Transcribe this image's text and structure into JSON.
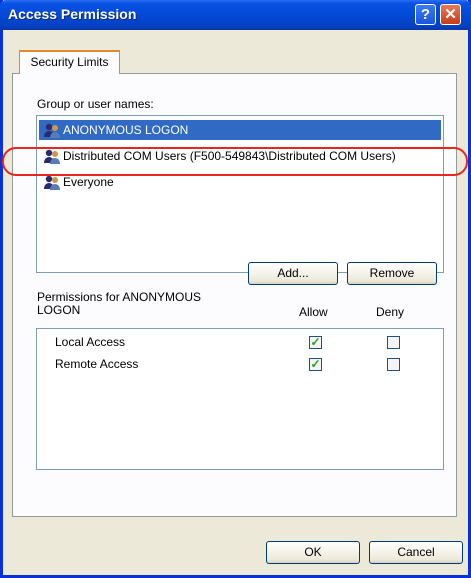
{
  "window": {
    "title": "Access Permission",
    "help_label": "?",
    "close_label": "✕"
  },
  "tab": {
    "label": "Security Limits"
  },
  "groups": {
    "label": "Group or user names:",
    "items": [
      {
        "name": "ANONYMOUS LOGON",
        "selected": true,
        "icon": "user-group-icon"
      },
      {
        "name": "Distributed COM Users (F500-549843\\Distributed COM Users)",
        "selected": false,
        "icon": "user-group-icon"
      },
      {
        "name": "Everyone",
        "selected": false,
        "icon": "user-group-icon"
      }
    ]
  },
  "buttons": {
    "add": "Add...",
    "remove": "Remove",
    "ok": "OK",
    "cancel": "Cancel"
  },
  "permissions": {
    "label_line1": "Permissions for ANONYMOUS",
    "label_line2": "LOGON",
    "allow_header": "Allow",
    "deny_header": "Deny",
    "rows": [
      {
        "name": "Local Access",
        "allow": true,
        "deny": false
      },
      {
        "name": "Remote Access",
        "allow": true,
        "deny": false
      }
    ]
  },
  "colors": {
    "selection": "#316ac5",
    "annotation": "#e8261d",
    "title_bar": "#0a52e4"
  }
}
